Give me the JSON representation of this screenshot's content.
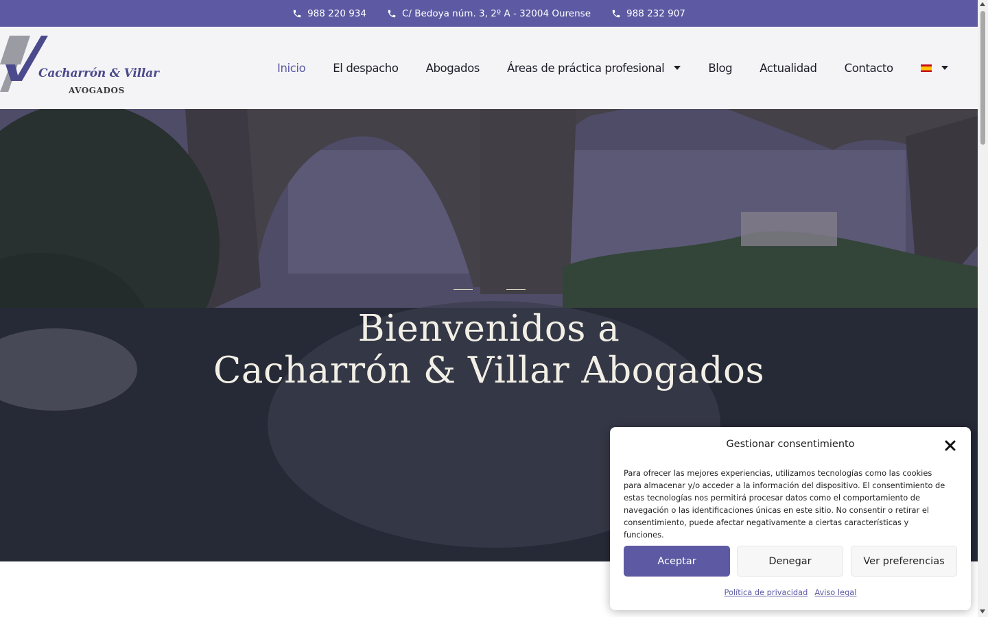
{
  "topbar": {
    "phone1": "988 220 934",
    "address": "C/ Bedoya núm. 3, 2º A - 32004 Ourense",
    "phone2": "988 232 907"
  },
  "logo": {
    "name": "Cacharrón & Villar",
    "subtitle": "AVOGADOS"
  },
  "nav": {
    "items": [
      {
        "label": "Inicio",
        "active": true
      },
      {
        "label": "El despacho"
      },
      {
        "label": "Abogados"
      },
      {
        "label": "Áreas de práctica profesional",
        "dropdown": true
      },
      {
        "label": "Blog"
      },
      {
        "label": "Actualidad"
      },
      {
        "label": "Contacto"
      }
    ],
    "language_icon": "spain-flag-icon"
  },
  "hero": {
    "line1": "Bienvenidos a",
    "line2": "Cacharrón & Villar Abogados"
  },
  "cookie": {
    "title": "Gestionar consentimiento",
    "text": "Para ofrecer las mejores experiencias, utilizamos tecnologías como las cookies para almacenar y/o acceder a la información del dispositivo. El consentimiento de estas tecnologías nos permitirá procesar datos como el comportamiento de navegación o las identificaciones únicas en este sitio. No consentir o retirar el consentimiento, puede afectar negativamente a ciertas características y funciones.",
    "accept": "Aceptar",
    "deny": "Denegar",
    "preferences": "Ver preferencias",
    "privacy_link": "Política de privacidad",
    "legal_link": "Aviso legal"
  },
  "colors": {
    "brand": "#5d5aa3",
    "header_bg": "#f4f4f6"
  }
}
